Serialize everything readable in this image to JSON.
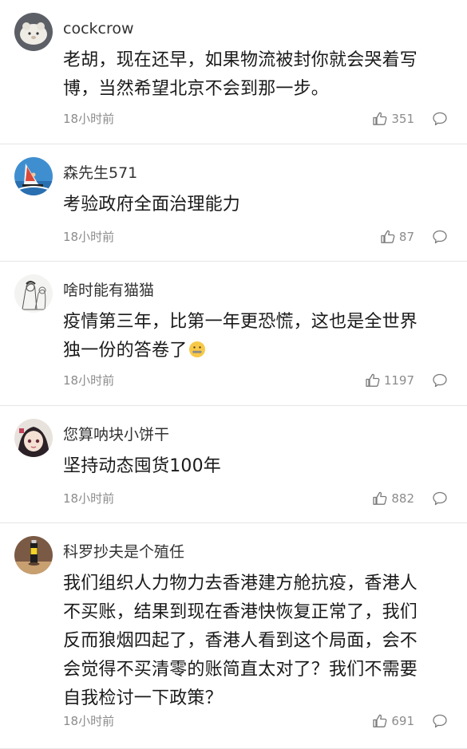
{
  "comments": [
    {
      "username": "cockcrow",
      "text_lines": [
        "老胡，现在还早，如果物流被封你就会哭着写",
        "博，当然希望北京不会到那一步。"
      ],
      "time": "18小时前",
      "likes": "351",
      "avatar_icon": "white-animal-avatar"
    },
    {
      "username": "森先生571",
      "text_lines": [
        "考验政府全面治理能力"
      ],
      "time": "18小时前",
      "likes": "87",
      "avatar_icon": "windsurf-avatar"
    },
    {
      "username": "啥时能有猫猫",
      "text_lines": [
        "疫情第三年，比第一年更恐慌，这也是全世界",
        "独一份的答卷了"
      ],
      "emoji": "zipper-mouth-emoji",
      "time": "18小时前",
      "likes": "1197",
      "avatar_icon": "sketch-avatar"
    },
    {
      "username": "您算呐块小饼干",
      "text_lines": [
        "坚持动态囤货100年"
      ],
      "time": "18小时前",
      "likes": "882",
      "avatar_icon": "anime-avatar"
    },
    {
      "username": "科罗抄夫是个殖任",
      "text_lines": [
        "我们组织人力物力去香港建方舱抗疫，香港人",
        "不买账，结果到现在香港快恢复正常了，我们",
        "反而狼烟四起了，香港人看到这个局面，会不",
        "会觉得不买清零的账简直太对了？我们不需要",
        "自我检讨一下政策？"
      ],
      "time": "18小时前",
      "likes": "691",
      "avatar_icon": "bottle-avatar"
    }
  ],
  "colors": {
    "text": "#1a1a1a",
    "meta": "#8c8c8c",
    "divider": "#e6e6e6"
  }
}
